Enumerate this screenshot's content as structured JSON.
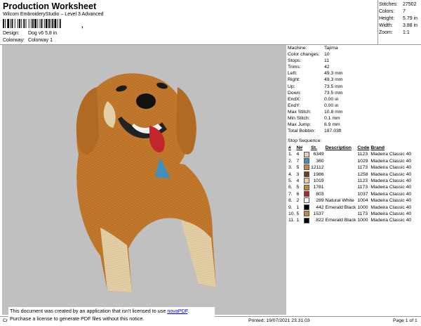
{
  "header": {
    "title": "Production Worksheet",
    "subtitle": "Wilcom EmbroideryStudio – Level 3 Advanced",
    "design_label": "Design:",
    "design_value": "Dog v6 5,8 in",
    "colorway_label": "Colorway:",
    "colorway_value": "Colorway 1"
  },
  "stats": [
    {
      "label": "Stitches:",
      "value": "27502"
    },
    {
      "label": "Colors:",
      "value": "7"
    },
    {
      "label": "Height:",
      "value": "5.79 in"
    },
    {
      "label": "Width:",
      "value": "3.88 in"
    },
    {
      "label": "Zoom:",
      "value": "1:1"
    }
  ],
  "machine_info": [
    {
      "label": "Machine:",
      "value": "Tajima"
    },
    {
      "label": "Color changes:",
      "value": "10"
    },
    {
      "label": "Stops:",
      "value": "11"
    },
    {
      "label": "Trims:",
      "value": "42"
    },
    {
      "label": "Left:",
      "value": "49.3 mm"
    },
    {
      "label": "Right:",
      "value": "49.3 mm"
    },
    {
      "label": "Up:",
      "value": "73.5 mm"
    },
    {
      "label": "Down:",
      "value": "73.5 mm"
    },
    {
      "label": "EndX:",
      "value": "0.00 in"
    },
    {
      "label": "EndY:",
      "value": "0.00 in"
    },
    {
      "label": "Max Stitch:",
      "value": "10.8 mm"
    },
    {
      "label": "Min Stitch:",
      "value": "0.1 mm"
    },
    {
      "label": "Max Jump:",
      "value": "6.9 mm"
    },
    {
      "label": "Total Bobbin:",
      "value": "187.03ft"
    }
  ],
  "stop_sequence": {
    "label": "Stop Sequence:",
    "headers": [
      "#",
      "N#",
      "",
      "St.",
      "Description",
      "Code",
      "Brand"
    ],
    "rows": [
      {
        "n": "1.",
        "needle": "4",
        "color": "#e6cdb0",
        "st": "6349",
        "desc": "",
        "code": "1123",
        "brand": "Madeira Classic 40"
      },
      {
        "n": "2.",
        "needle": "7",
        "color": "#3f8fbf",
        "st": "360",
        "desc": "",
        "code": "1029",
        "brand": "Madeira Classic 40"
      },
      {
        "n": "3.",
        "needle": "5",
        "color": "#c9843a",
        "st": "12112",
        "desc": "",
        "code": "1173",
        "brand": "Madeira Classic 40"
      },
      {
        "n": "4.",
        "needle": "3",
        "color": "#6b3d1e",
        "st": "1986",
        "desc": "",
        "code": "1258",
        "brand": "Madeira Classic 40"
      },
      {
        "n": "5.",
        "needle": "4",
        "color": "#e6cdb0",
        "st": "1019",
        "desc": "",
        "code": "1123",
        "brand": "Madeira Classic 40"
      },
      {
        "n": "6.",
        "needle": "5",
        "color": "#c9843a",
        "st": "1781",
        "desc": "",
        "code": "1173",
        "brand": "Madeira Classic 40"
      },
      {
        "n": "7.",
        "needle": "6",
        "color": "#b22222",
        "st": "803",
        "desc": "",
        "code": "1037",
        "brand": "Madeira Classic 40"
      },
      {
        "n": "8.",
        "needle": "2",
        "color": "#f4f4f4",
        "st": "289",
        "desc": "Natural White",
        "code": "1004",
        "brand": "Madeira Classic 40"
      },
      {
        "n": "9.",
        "needle": "1",
        "color": "#000000",
        "st": "442",
        "desc": "Emerald Black",
        "code": "1000",
        "brand": "Madeira Classic 40"
      },
      {
        "n": "10.",
        "needle": "5",
        "color": "#c9843a",
        "st": "1537",
        "desc": "",
        "code": "1173",
        "brand": "Madeira Classic 40"
      },
      {
        "n": "11.",
        "needle": "1",
        "color": "#000000",
        "st": "822",
        "desc": "Emerald Black",
        "code": "1000",
        "brand": "Madeira Classic 40"
      }
    ]
  },
  "footer": {
    "left": "Cr",
    "printed": "Printed: 19/07/2021 23.31.03",
    "page": "Page 1 of 1"
  },
  "watermark_note": {
    "line1_prefix": "This document was created by an application that isn't licensed to use ",
    "link": "novaPDF",
    "line1_suffix": ".",
    "line2": "Purchase a license to generate PDF files without this notice."
  }
}
